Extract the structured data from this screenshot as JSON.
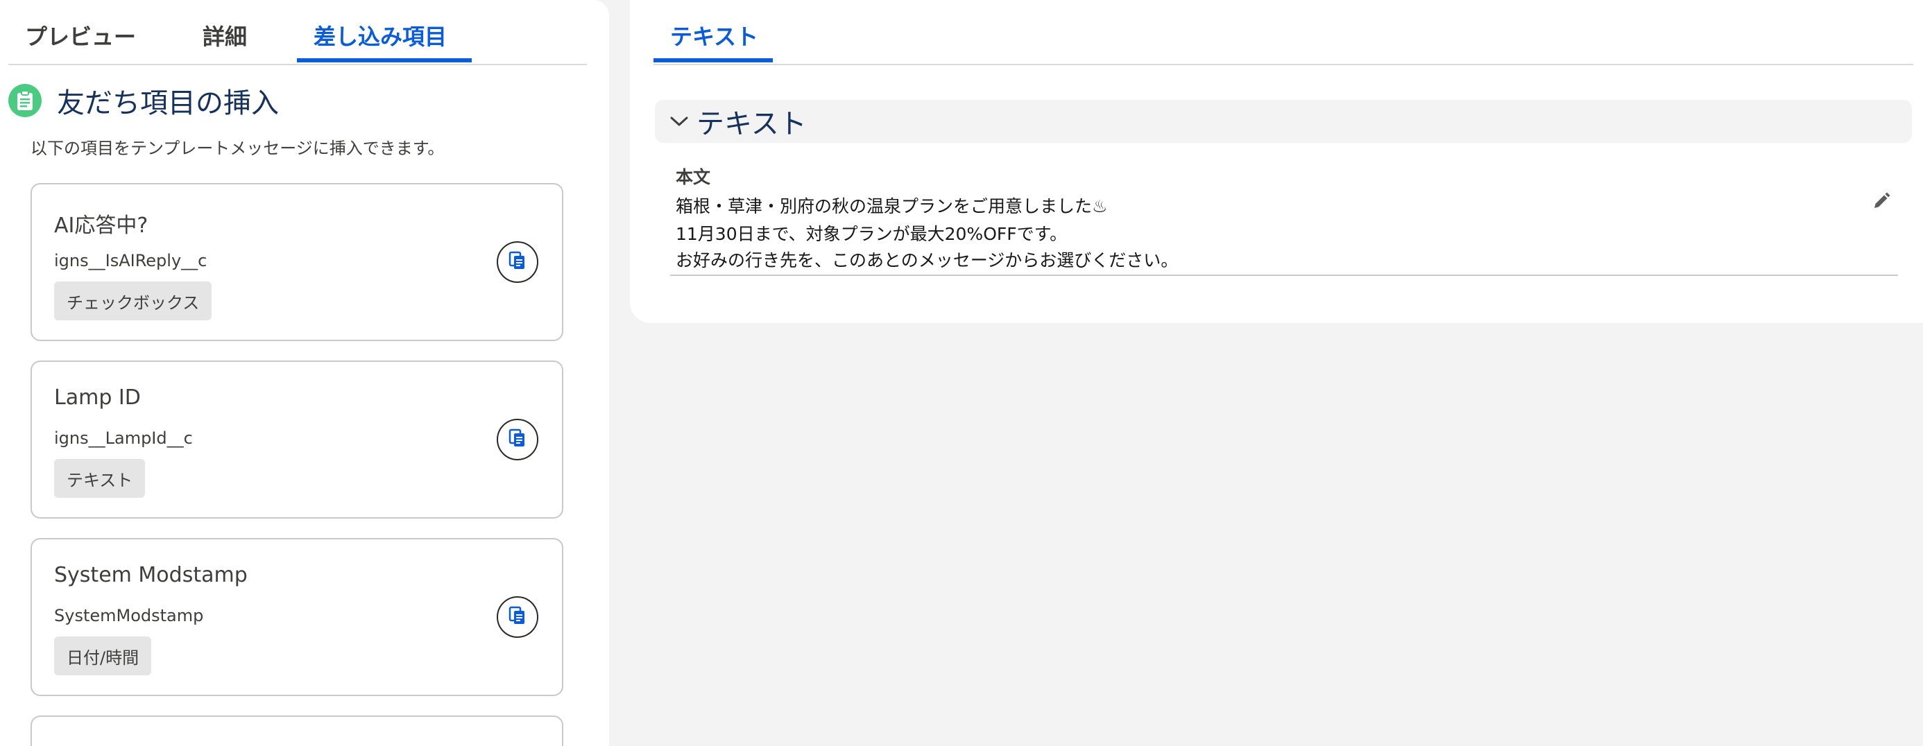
{
  "left_tabs": [
    {
      "label": "プレビュー"
    },
    {
      "label": "詳細"
    },
    {
      "label": "差し込み項目"
    }
  ],
  "section": {
    "title": "友だち項目の挿入",
    "description": "以下の項目をテンプレートメッセージに挿入できます。"
  },
  "cards": [
    {
      "title": "AI応答中?",
      "api_name": "igns__IsAIReply__c",
      "type": "チェックボックス"
    },
    {
      "title": "Lamp ID",
      "api_name": "igns__LampId__c",
      "type": "テキスト"
    },
    {
      "title": "System Modstamp",
      "api_name": "SystemModstamp",
      "type": "日付/時間"
    }
  ],
  "right_tabs": [
    {
      "label": "テキスト"
    }
  ],
  "accordion": {
    "title": "テキスト"
  },
  "field": {
    "label": "本文",
    "lines": [
      "箱根・草津・別府の秋の温泉プランをご用意しました♨",
      "11月30日まで、対象プランが最大20%OFFです。",
      "お好みの行き先を、このあとのメッセージからお選びください。"
    ]
  },
  "icons": {
    "section": "clipboard-icon",
    "copy": "copy-icon",
    "chevron": "chevron-down-icon",
    "edit": "pencil-icon"
  },
  "colors": {
    "accent": "#0b5cd5",
    "section_icon": "#4bca81",
    "title": "#16325c"
  }
}
